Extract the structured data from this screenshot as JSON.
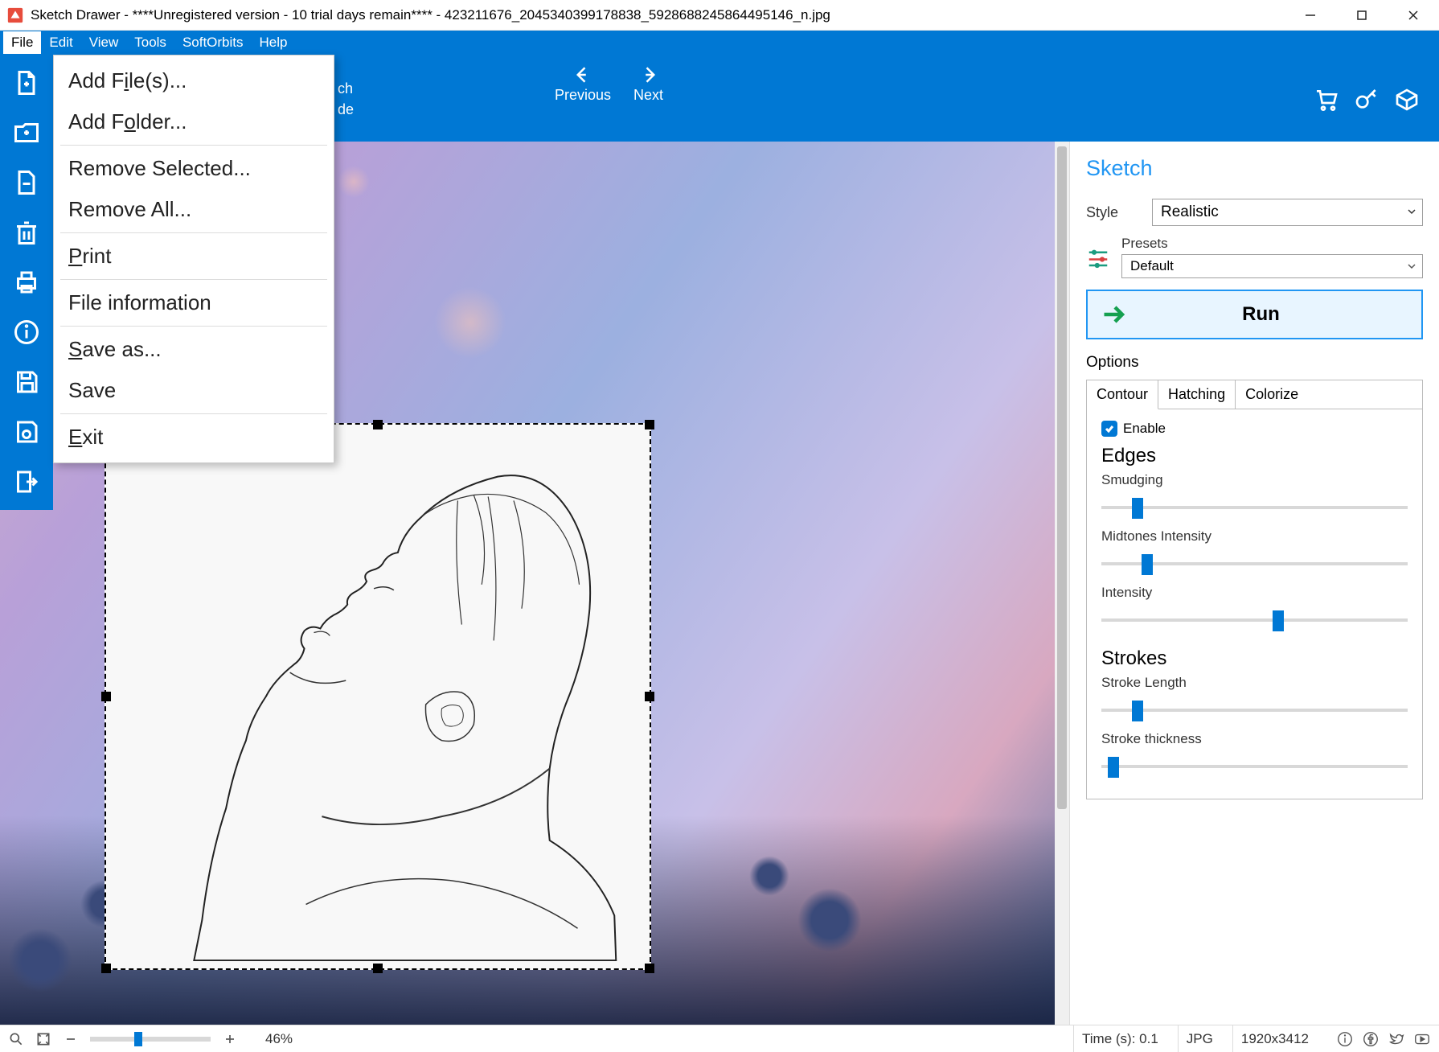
{
  "title": "Sketch Drawer - ****Unregistered version - 10 trial days remain**** - 423211676_2045340399178838_5928688245864495146_n.jpg",
  "menu": {
    "file": "File",
    "edit": "Edit",
    "view": "View",
    "tools": "Tools",
    "softorbits": "SoftOrbits",
    "help": "Help"
  },
  "ribbon": {
    "previous": "Previous",
    "next": "Next",
    "hidden_label_right": "de",
    "hidden_label_top": "ch"
  },
  "file_menu": {
    "add_files": "Add File(s)...",
    "add_folder": "Add Folder...",
    "remove_selected": "Remove Selected...",
    "remove_all": "Remove All...",
    "print": "Print",
    "file_info": "File information",
    "save_as": "Save as...",
    "save": "Save",
    "exit": "Exit"
  },
  "sketch_panel": {
    "heading": "Sketch",
    "style_label": "Style",
    "style_value": "Realistic",
    "presets_label": "Presets",
    "presets_value": "Default",
    "run": "Run",
    "options": "Options",
    "tabs": {
      "contour": "Contour",
      "hatching": "Hatching",
      "colorize": "Colorize"
    },
    "enable": "Enable",
    "edges_h": "Edges",
    "smudging": "Smudging",
    "midtones": "Midtones Intensity",
    "intensity": "Intensity",
    "strokes_h": "Strokes",
    "stroke_length": "Stroke Length",
    "stroke_thickness": "Stroke thickness",
    "sliders": {
      "smudging": 10,
      "midtones": 13,
      "intensity": 56,
      "stroke_length": 10,
      "stroke_thickness": 2
    }
  },
  "statusbar": {
    "zoom_pct": "46%",
    "time": "Time (s): 0.1",
    "format": "JPG",
    "dims": "1920x3412"
  }
}
